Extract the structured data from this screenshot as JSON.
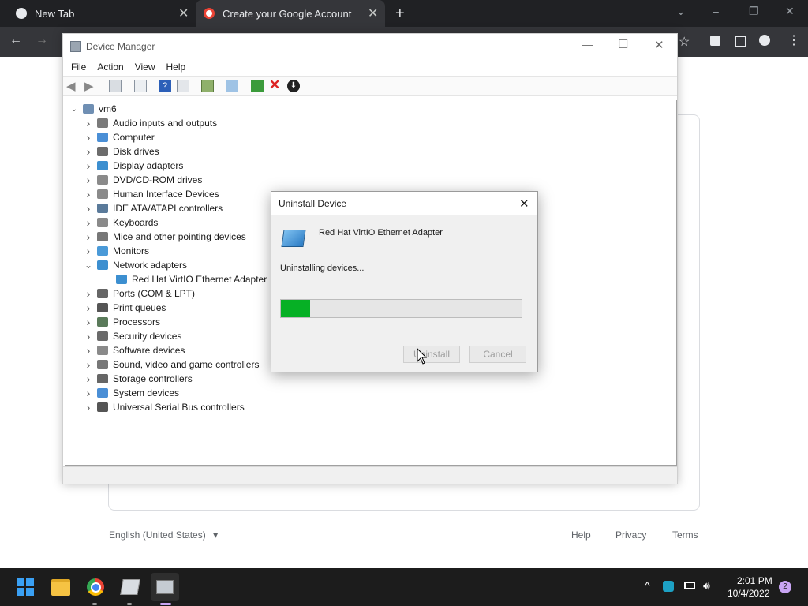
{
  "browser": {
    "tabs": [
      {
        "title": "New Tab"
      },
      {
        "title": "Create your Google Account"
      }
    ],
    "new_tab": "+",
    "window_controls": {
      "minimize": "–",
      "restore": "❐",
      "close": "✕",
      "dropdown": "⌄"
    },
    "back": "←",
    "forward": "→"
  },
  "page": {
    "language_selector": "English (United States)",
    "footer_links": [
      "Help",
      "Privacy",
      "Terms"
    ]
  },
  "device_manager": {
    "title": "Device Manager",
    "menu": [
      "File",
      "Action",
      "View",
      "Help"
    ],
    "window_controls": {
      "minimize": "—",
      "maximize": "☐",
      "close": "✕"
    },
    "root": "vm6",
    "categories": [
      {
        "label": "Audio inputs and outputs",
        "expanded": false
      },
      {
        "label": "Computer",
        "expanded": false
      },
      {
        "label": "Disk drives",
        "expanded": false
      },
      {
        "label": "Display adapters",
        "expanded": false
      },
      {
        "label": "DVD/CD-ROM drives",
        "expanded": false
      },
      {
        "label": "Human Interface Devices",
        "expanded": false
      },
      {
        "label": "IDE ATA/ATAPI controllers",
        "expanded": false
      },
      {
        "label": "Keyboards",
        "expanded": false
      },
      {
        "label": "Mice and other pointing devices",
        "expanded": false
      },
      {
        "label": "Monitors",
        "expanded": false
      },
      {
        "label": "Network adapters",
        "expanded": true
      },
      {
        "label": "Red Hat VirtIO Ethernet Adapter",
        "child": true
      },
      {
        "label": "Ports (COM & LPT)",
        "expanded": false
      },
      {
        "label": "Print queues",
        "expanded": false
      },
      {
        "label": "Processors",
        "expanded": false
      },
      {
        "label": "Security devices",
        "expanded": false
      },
      {
        "label": "Software devices",
        "expanded": false
      },
      {
        "label": "Sound, video and game controllers",
        "expanded": false
      },
      {
        "label": "Storage controllers",
        "expanded": false
      },
      {
        "label": "System devices",
        "expanded": false
      },
      {
        "label": "Universal Serial Bus controllers",
        "expanded": false
      }
    ]
  },
  "dialog": {
    "title": "Uninstall Device",
    "close": "✕",
    "device_name": "Red Hat VirtIO Ethernet Adapter",
    "status": "Uninstalling devices...",
    "progress": 0.12,
    "uninstall_button": "Uninstall",
    "cancel_button": "Cancel"
  },
  "taskbar": {
    "time": "2:01 PM",
    "date": "10/4/2022",
    "notification_count": "2",
    "overflow": "^"
  },
  "colors": {
    "chrome_dark": "#202124",
    "chrome_toolbar": "#35363a",
    "progress_green": "#06b025",
    "taskbar": "#1c1c1c",
    "notification_badge": "#c9a5f4"
  }
}
